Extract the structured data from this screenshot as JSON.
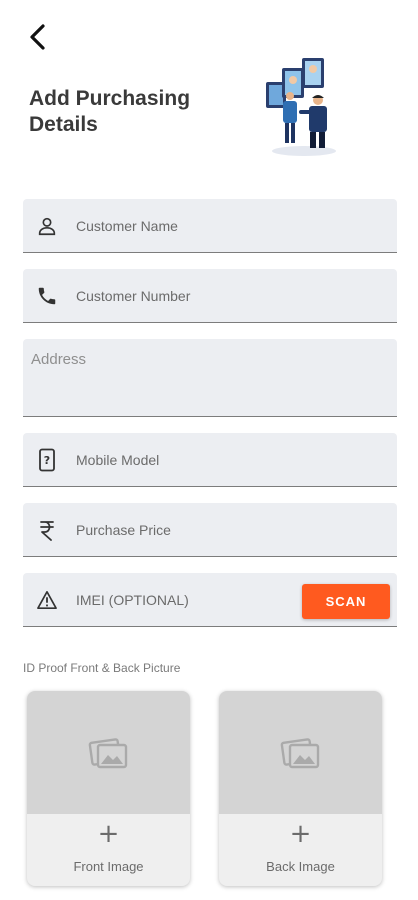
{
  "header": {
    "back_icon": "chevron-left-icon",
    "title": "Add Purchasing Details",
    "illustration": "business-meeting-illustration"
  },
  "form": {
    "customer_name": {
      "icon": "person-icon",
      "placeholder": "Customer Name"
    },
    "customer_number": {
      "icon": "phone-icon",
      "placeholder": "Customer Number"
    },
    "address": {
      "placeholder": "Address"
    },
    "mobile_model": {
      "icon": "mobile-question-icon",
      "placeholder": "Mobile Model"
    },
    "purchase_price": {
      "icon": "rupee-icon",
      "placeholder": "Purchase Price"
    },
    "imei": {
      "icon": "warning-icon",
      "placeholder": "IMEI (OPTIONAL)",
      "scan_label": "SCAN"
    }
  },
  "id_proof": {
    "label": "ID Proof Front & Back Picture",
    "front": {
      "icon": "image-icon",
      "plus": "+",
      "caption": "Front Image"
    },
    "back": {
      "icon": "image-icon",
      "plus": "+",
      "caption": "Back Image"
    }
  },
  "colors": {
    "accent": "#ff5a1f",
    "field_bg": "#eceef2",
    "preview_bg": "#d4d4d4"
  }
}
